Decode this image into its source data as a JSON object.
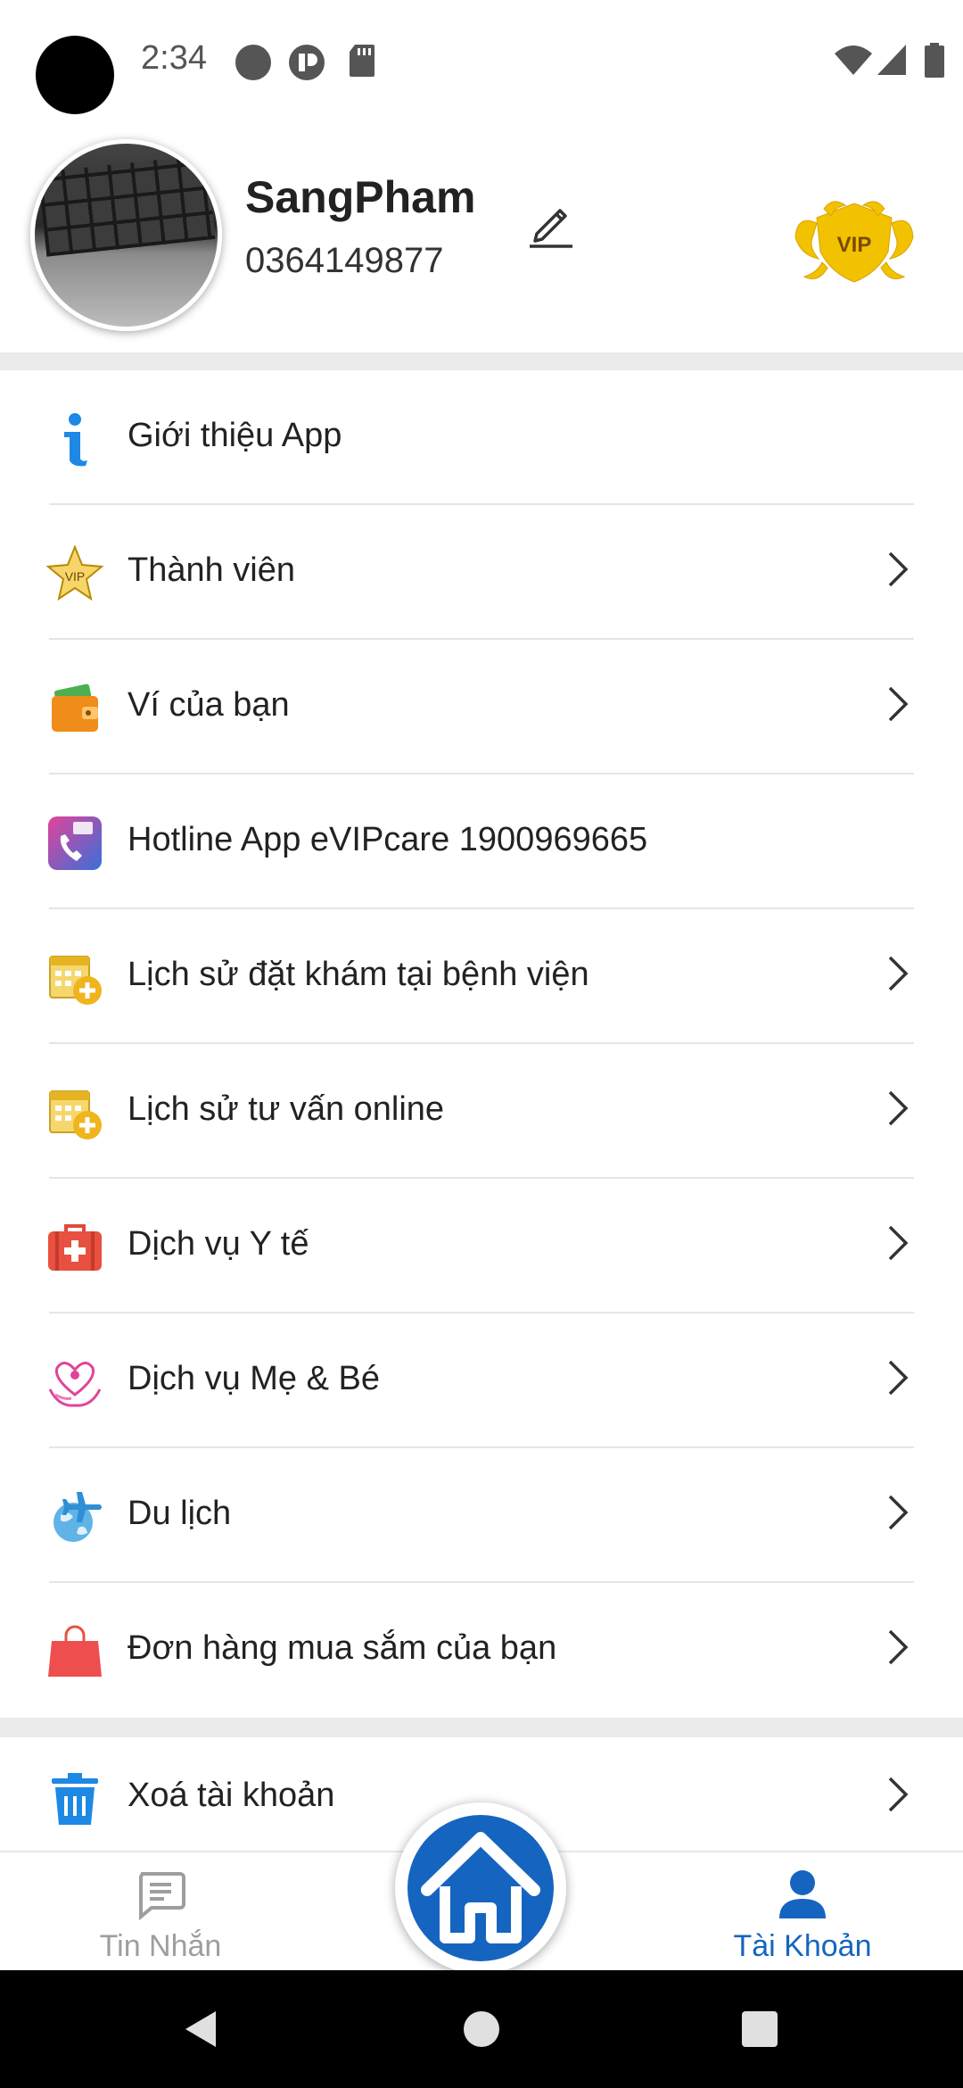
{
  "status_bar": {
    "time": "2:34",
    "icons": [
      "notification-dot-icon",
      "app-notification-icon",
      "sd-card-icon",
      "wifi-icon",
      "signal-icon",
      "battery-icon"
    ]
  },
  "profile": {
    "name": "SangPham",
    "phone": "0364149877",
    "badge_text": "VIP",
    "badge_color": "#f2c200"
  },
  "menu": {
    "items": [
      {
        "label": "Giới thiệu App",
        "icon": "info-icon",
        "has_chevron": false
      },
      {
        "label": "Thành viên",
        "icon": "vip-star-icon",
        "has_chevron": true
      },
      {
        "label": "Ví của bạn",
        "icon": "wallet-icon",
        "has_chevron": true
      },
      {
        "label": "Hotline App eVIPcare 1900969665",
        "icon": "hotline-phone-icon",
        "has_chevron": false
      },
      {
        "label": "Lịch sử đặt khám tại bệnh viện",
        "icon": "calendar-plus-icon",
        "has_chevron": true
      },
      {
        "label": "Lịch sử tư vấn online",
        "icon": "calendar-plus-icon",
        "has_chevron": true
      },
      {
        "label": "Dịch vụ Y tế",
        "icon": "medical-kit-icon",
        "has_chevron": true
      },
      {
        "label": "Dịch vụ Mẹ & Bé",
        "icon": "mother-baby-icon",
        "has_chevron": true
      },
      {
        "label": "Du lịch",
        "icon": "travel-plane-icon",
        "has_chevron": true
      },
      {
        "label": "Đơn hàng mua sắm của bạn",
        "icon": "shopping-bag-icon",
        "has_chevron": true
      }
    ],
    "delete_account": {
      "label": "Xoá tài khoản",
      "icon": "trash-icon",
      "has_chevron": true
    }
  },
  "bottom_nav": {
    "messages_label": "Tin Nhắn",
    "account_label": "Tài Khoản",
    "active": "account",
    "active_color": "#1565c0",
    "inactive_color": "#9e9e9e"
  }
}
